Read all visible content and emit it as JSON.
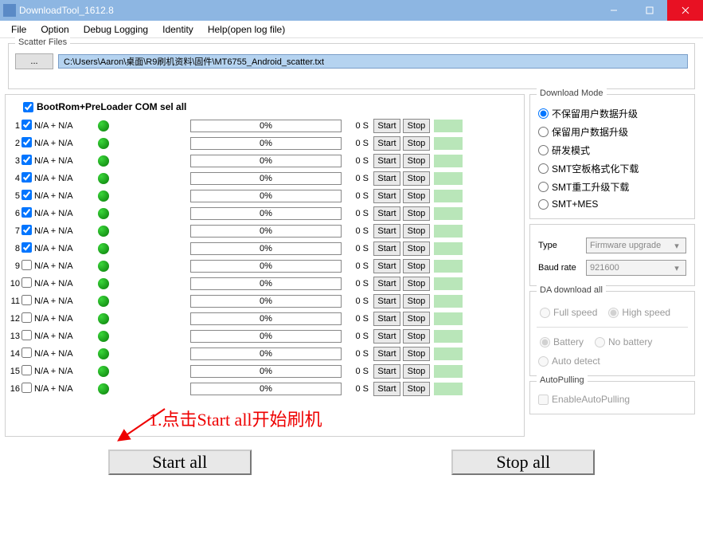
{
  "window": {
    "title": "DownloadTool_1612.8"
  },
  "menu": [
    "File",
    "Option",
    "Debug Logging",
    "Identity",
    "Help(open log file)"
  ],
  "scatter": {
    "legend": "Scatter Files",
    "button": "...",
    "path": "C:\\Users\\Aaron\\桌面\\R9刷机资料\\固件\\MT6755_Android_scatter.txt"
  },
  "selall": {
    "label": "BootRom+PreLoader COM sel all"
  },
  "rows": [
    {
      "n": "1",
      "label": "N/A + N/A",
      "checked": true,
      "pct": "0%",
      "time": "0 S",
      "start": "Start",
      "stop": "Stop"
    },
    {
      "n": "2",
      "label": "N/A + N/A",
      "checked": true,
      "pct": "0%",
      "time": "0 S",
      "start": "Start",
      "stop": "Stop"
    },
    {
      "n": "3",
      "label": "N/A + N/A",
      "checked": true,
      "pct": "0%",
      "time": "0 S",
      "start": "Start",
      "stop": "Stop"
    },
    {
      "n": "4",
      "label": "N/A + N/A",
      "checked": true,
      "pct": "0%",
      "time": "0 S",
      "start": "Start",
      "stop": "Stop"
    },
    {
      "n": "5",
      "label": "N/A + N/A",
      "checked": true,
      "pct": "0%",
      "time": "0 S",
      "start": "Start",
      "stop": "Stop"
    },
    {
      "n": "6",
      "label": "N/A + N/A",
      "checked": true,
      "pct": "0%",
      "time": "0 S",
      "start": "Start",
      "stop": "Stop"
    },
    {
      "n": "7",
      "label": "N/A + N/A",
      "checked": true,
      "pct": "0%",
      "time": "0 S",
      "start": "Start",
      "stop": "Stop"
    },
    {
      "n": "8",
      "label": "N/A + N/A",
      "checked": true,
      "pct": "0%",
      "time": "0 S",
      "start": "Start",
      "stop": "Stop"
    },
    {
      "n": "9",
      "label": "N/A + N/A",
      "checked": false,
      "pct": "0%",
      "time": "0 S",
      "start": "Start",
      "stop": "Stop"
    },
    {
      "n": "10",
      "label": "N/A + N/A",
      "checked": false,
      "pct": "0%",
      "time": "0 S",
      "start": "Start",
      "stop": "Stop"
    },
    {
      "n": "11",
      "label": "N/A + N/A",
      "checked": false,
      "pct": "0%",
      "time": "0 S",
      "start": "Start",
      "stop": "Stop"
    },
    {
      "n": "12",
      "label": "N/A + N/A",
      "checked": false,
      "pct": "0%",
      "time": "0 S",
      "start": "Start",
      "stop": "Stop"
    },
    {
      "n": "13",
      "label": "N/A + N/A",
      "checked": false,
      "pct": "0%",
      "time": "0 S",
      "start": "Start",
      "stop": "Stop"
    },
    {
      "n": "14",
      "label": "N/A + N/A",
      "checked": false,
      "pct": "0%",
      "time": "0 S",
      "start": "Start",
      "stop": "Stop"
    },
    {
      "n": "15",
      "label": "N/A + N/A",
      "checked": false,
      "pct": "0%",
      "time": "0 S",
      "start": "Start",
      "stop": "Stop"
    },
    {
      "n": "16",
      "label": "N/A + N/A",
      "checked": false,
      "pct": "0%",
      "time": "0 S",
      "start": "Start",
      "stop": "Stop"
    }
  ],
  "annotation": "1.点击Start all开始刷机",
  "bigbtns": {
    "start": "Start all",
    "stop": "Stop all"
  },
  "downloadMode": {
    "legend": "Download Mode",
    "opts": [
      "不保留用户数据升级",
      "保留用户数据升级",
      "研发模式",
      "SMT空板格式化下载",
      "SMT重工升级下载",
      "SMT+MES"
    ]
  },
  "type": {
    "label": "Type",
    "value": "Firmware upgrade"
  },
  "baud": {
    "label": "Baud rate",
    "value": "921600"
  },
  "da": {
    "legend": "DA download all",
    "full": "Full speed",
    "high": "High speed",
    "battery": "Battery",
    "nobattery": "No battery",
    "auto": "Auto detect"
  },
  "autopull": {
    "legend": "AutoPulling",
    "chk": "EnableAutoPulling"
  }
}
